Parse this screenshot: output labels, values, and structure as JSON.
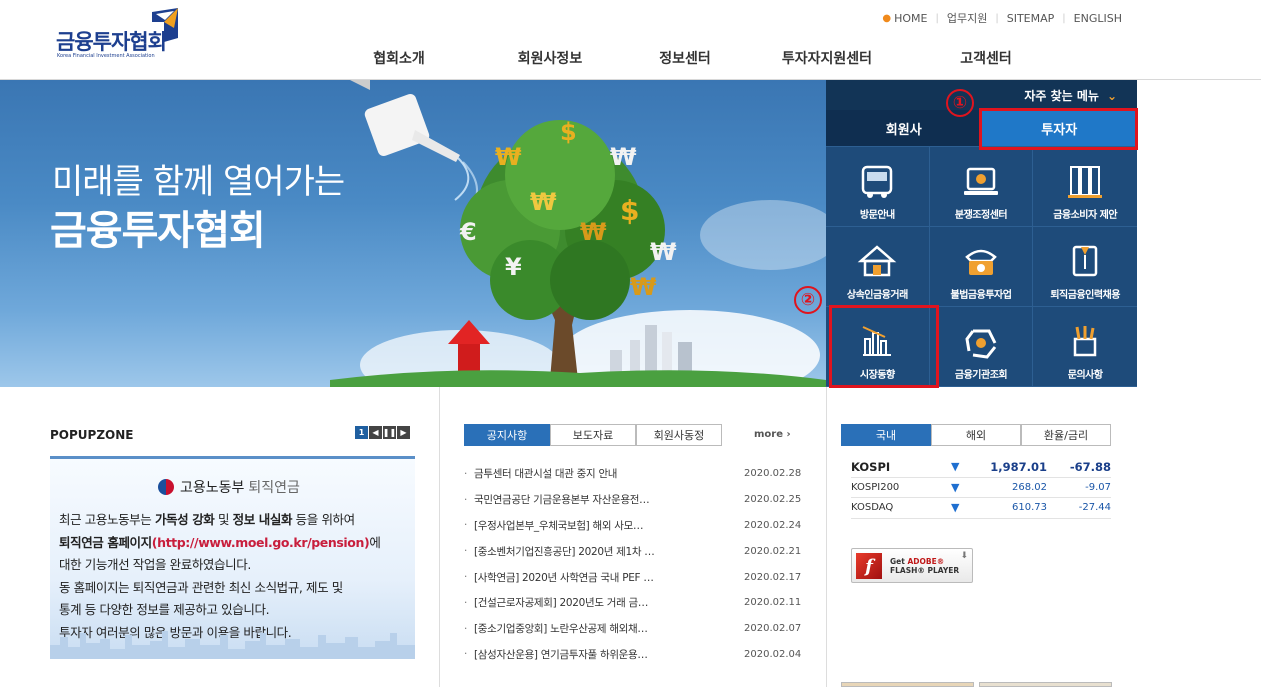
{
  "header": {
    "logo_text": "금융투자협회",
    "logo_sub": "Korea Financial Investment Association",
    "util": [
      "HOME",
      "업무지원",
      "SITEMAP",
      "ENGLISH"
    ],
    "gnb": [
      "협회소개",
      "회원사정보",
      "정보센터",
      "투자자지원센터",
      "고객센터"
    ]
  },
  "hero": {
    "line1": "미래를 함께 열어가는",
    "line2": "금융투자협회"
  },
  "quick_menu": {
    "title": "자주 찾는 메뉴",
    "tabs": [
      "회원사",
      "투자자"
    ],
    "items": [
      "방문안내",
      "분쟁조정센터",
      "금융소비자 제안",
      "상속인금융거래",
      "불법금융투자업",
      "퇴직금융인력채용",
      "시장동향",
      "금융기관조회",
      "문의사항"
    ]
  },
  "annotations": {
    "one": "①",
    "two": "②"
  },
  "popupzone": {
    "title": "POPUPZONE",
    "page": "1",
    "ministry": "고용노동부",
    "ministry_sub": "퇴직연금",
    "body_line1_a": "최근 고용노동부는 ",
    "body_line1_b": "가독성 강화",
    "body_line1_c": " 및 ",
    "body_line1_d": "정보 내실화",
    "body_line1_e": " 등을 위하여",
    "body_line2_a": "퇴직연금 홈페이지",
    "body_line2_b": "(http://www.moel.go.kr/pension)",
    "body_line2_c": "에",
    "body_line3": "대한 기능개선 작업을 완료하였습니다.",
    "body_line4": "동 홈페이지는 퇴직연금과 관련한 최신 소식법규, 제도 및",
    "body_line5": "통계 등 다양한 정보를 제공하고 있습니다.",
    "body_line6": "투자자 여러분의 많은 방문과 이용을 바랍니다."
  },
  "notice": {
    "tabs": [
      "공지사항",
      "보도자료",
      "회원사동정"
    ],
    "more": "more",
    "items": [
      {
        "title": "금투센터 대관시설 대관 중지 안내",
        "date": "2020.02.28"
      },
      {
        "title": "국민연금공단 기금운용본부 자산운용전…",
        "date": "2020.02.25"
      },
      {
        "title": "[우정사업본부_우체국보험] 해외 사모…",
        "date": "2020.02.24"
      },
      {
        "title": "[중소벤처기업진흥공단] 2020년 제1차 …",
        "date": "2020.02.21"
      },
      {
        "title": "[사학연금] 2020년 사학연금 국내 PEF …",
        "date": "2020.02.17"
      },
      {
        "title": "[건설근로자공제회] 2020년도 거래 금…",
        "date": "2020.02.11"
      },
      {
        "title": "[중소기업중앙회] 노란우산공제 해외채…",
        "date": "2020.02.07"
      },
      {
        "title": "[삼성자산운용] 연기금투자풀 하위운용…",
        "date": "2020.02.04"
      }
    ]
  },
  "market": {
    "tabs": [
      "국내",
      "해외",
      "환율/금리"
    ],
    "rows": [
      {
        "name": "KOSPI",
        "value": "1,987.01",
        "change": "-67.88"
      },
      {
        "name": "KOSPI200",
        "value": "268.02",
        "change": "-9.07"
      },
      {
        "name": "KOSDAQ",
        "value": "610.73",
        "change": "-27.44"
      }
    ]
  },
  "flash": {
    "line1": "Get ",
    "adobe": "ADOBE®",
    "line2": "FLASH® PLAYER"
  }
}
